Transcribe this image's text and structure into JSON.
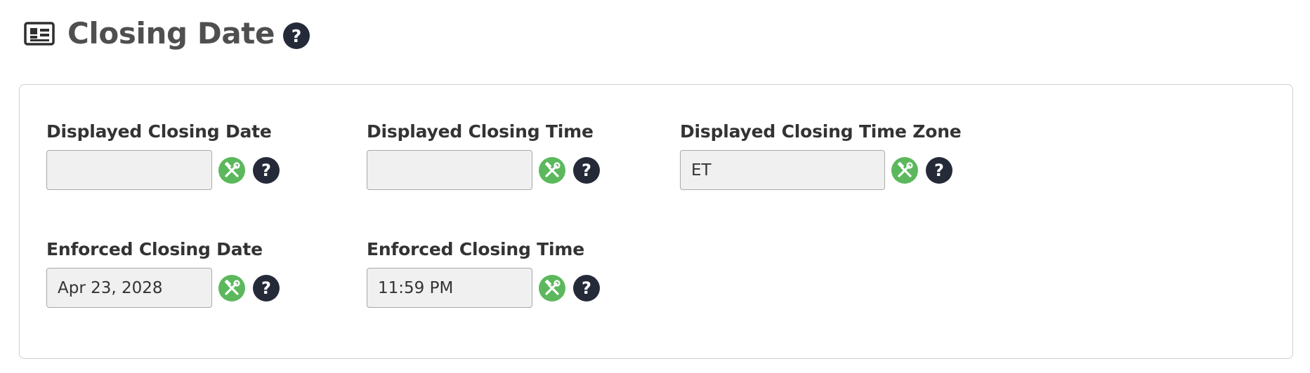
{
  "header": {
    "title": "Closing Date",
    "icon": "id-card-icon",
    "help_glyph": "?"
  },
  "colors": {
    "tool_button": "#5cb85c",
    "help_button": "#252a39",
    "input_background": "#f0f0f0"
  },
  "fields": {
    "displayed_closing_date": {
      "label": "Displayed Closing Date",
      "value": "",
      "tool_icon": "tools-icon",
      "help_glyph": "?"
    },
    "displayed_closing_time": {
      "label": "Displayed Closing Time",
      "value": "",
      "tool_icon": "tools-icon",
      "help_glyph": "?"
    },
    "displayed_closing_time_zone": {
      "label": "Displayed Closing Time Zone",
      "value": "ET",
      "tool_icon": "tools-icon",
      "help_glyph": "?"
    },
    "enforced_closing_date": {
      "label": "Enforced Closing Date",
      "value": "Apr 23, 2028",
      "tool_icon": "tools-icon",
      "help_glyph": "?"
    },
    "enforced_closing_time": {
      "label": "Enforced Closing Time",
      "value": "11:59 PM",
      "tool_icon": "tools-icon",
      "help_glyph": "?"
    }
  }
}
